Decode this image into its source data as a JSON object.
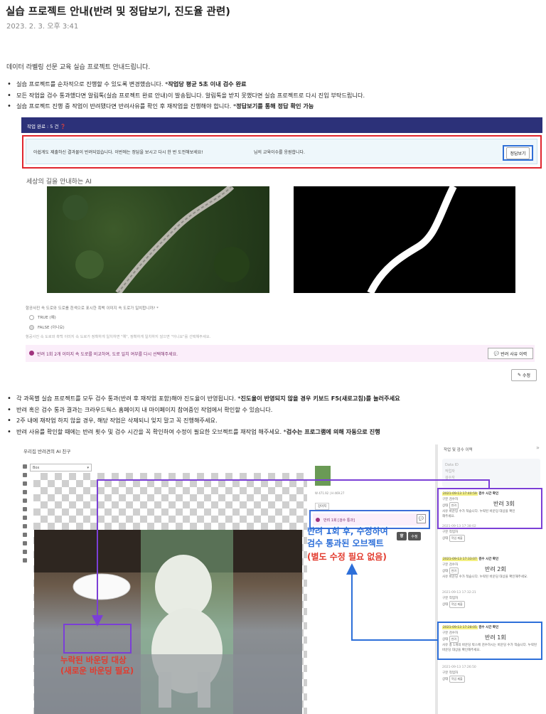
{
  "title": "실습 프로젝트 안내(반려 및 정답보기, 진도율 관련)",
  "date": "2023. 2. 3. 오후 3:41",
  "intro": "데이터 라벨링 선문 교육 실습 프로젝트 안내드립니다.",
  "bullets_1": [
    {
      "text": "실습 프로젝트를 순차적으로 진행할 수 있도록 변경했습니다. *",
      "bold": "작업당 평균 5초 이내 검수 완료"
    },
    {
      "text": "모든 작업을 검수 통과했다면 알림톡(실습 프로젝트 완료 안내)이 발송됩니다. 알림톡을 받지 못했다면 실습 프로젝트로 다시 진입 부탁드립니다.",
      "bold": ""
    },
    {
      "text": "실습 프로젝트 진행 중 작업이 반려됐다면 반려사유를 확인 후 재작업을 진행해야 합니다. *",
      "bold": "정답보기를 통해 정답 확인 가능"
    }
  ],
  "shot1": {
    "bar_text": "작업 완료 : 5 건",
    "notice": "아쉽게도 제출하신 결과물이 반려되었습니다. 이번에는 정답을 보시고 다시 한 번 도전해보세요!",
    "notice2": "님의 교육이수를 응원합니다.",
    "answer_button": "정답보기",
    "heading": "세상의 길을 안내하는 AI",
    "question": "항공사진 속 도로와 도로를 흰색으로 표시한 흑백 이미지 속 도로가 일치합니까? *",
    "option_true": "TRUE (예)",
    "option_false": "FALSE (아니요)",
    "hint": "항공사진 속 도로와 흑백 이미지 속 도로가 정확하게 일치하면 \"예\", 정확하게 일치하지 않으면 \"아니요\"를 선택해주세요.",
    "reject_text": "반려 1회  2개 이미지 속 도로를 비교하여, 도로 일치 여부를 다시 선택해주세요.",
    "reason_button": "반려 사유 이력",
    "edit_button": "수정"
  },
  "bullets_2": [
    {
      "text": "각 과목별 실습 프로젝트를 모두 검수 통과(반려 후 재작업 포함)해야 진도율이 반영됩니다. *",
      "bold": "진도율이 반영되지 않을 경우 키보드 F5(새로고침)를 눌러주세요"
    },
    {
      "text": "반려 혹은 검수 통과 결과는 크라우드웍스 홈페이지 내 마이페이지 참여중인 작업에서 확인할 수 있습니다.",
      "bold": ""
    },
    {
      "text": "2주 내에 재작업 하지 않을 경우, 해당 작업은 삭제되니 잊지 말고 꼭 진행해주세요.",
      "bold": ""
    },
    {
      "text": "반려 사유를 확인할 때에는 반려 횟수 및 검수 시간을 꼭 확인하여 수정이 필요한 오브젝트를 재작업 해주세요. *",
      "bold": "검수는 프로그램에 의해 자동으로 진행"
    }
  ],
  "shot2": {
    "title": "우리집 반려견의 AI 친구",
    "select": "Box",
    "meta": "W 471.92 | H 469.27",
    "tag": "강아지",
    "reject": "반려 1회 [검수 통과]",
    "btn_delete": "🗑",
    "btn_edit": "수정",
    "panel_title": "작업 및 검수 이력",
    "panel_close": "»",
    "data_id": "Data ID",
    "data_line1": "작업자",
    "data_line2": "검수자",
    "history": [
      {
        "ts": "2021-09-13 17:40:59",
        "head": "검수 시간 확인",
        "role": "검수자",
        "state": "반려",
        "count": "반려 3회",
        "reason": "바운딩 수가 적습니다. 누락된 바운딩 대상을 확인해주세요.",
        "highlight": true
      },
      {
        "ts": "2021-09-13 17:38:02",
        "head": "",
        "role": "작업자",
        "state": "작업 제출",
        "count": "",
        "reason": "",
        "highlight": false
      },
      {
        "ts": "2021-09-13 17:33:07",
        "head": "검수 시간 확인",
        "role": "검수자",
        "state": "반려",
        "count": "반려 2회",
        "reason": "바운딩 수가 적습니다. 누락된 바운딩 대상을 확인해주세요.",
        "highlight": true
      },
      {
        "ts": "2021-09-13 17:32:21",
        "head": "",
        "role": "작업자",
        "state": "작업 제출",
        "count": "",
        "reason": "",
        "highlight": false
      },
      {
        "ts": "2021-09-13 17:28:05",
        "head": "검수 시간 확인",
        "role": "검수자",
        "state": "반려",
        "count": "반려 1회",
        "reason": "총 1개의 바운딩 박스에 검수하시는 바운딩 수가 적습니다. 누락된 바운딩 대상을 확인해주세요.",
        "highlight": true
      },
      {
        "ts": "2021-09-13 17:26:50",
        "head": "",
        "role": "작업자",
        "state": "작업 제출",
        "count": "",
        "reason": "",
        "highlight": false
      }
    ]
  },
  "annotations": {
    "blue_line1": "반려 1회 후, 수정하여",
    "blue_line2": "검수 통과된 오브젝트",
    "red_note": "(별도 수정 필요 없음)",
    "missing_line1": "누락된 바운딩 대상",
    "missing_line2": "(새로운 바운딩 필요)"
  },
  "colors": {
    "blue": "#2d6fd9",
    "red": "#e23b2e",
    "purple": "#7b3fd6",
    "bar": "#2c3179"
  }
}
